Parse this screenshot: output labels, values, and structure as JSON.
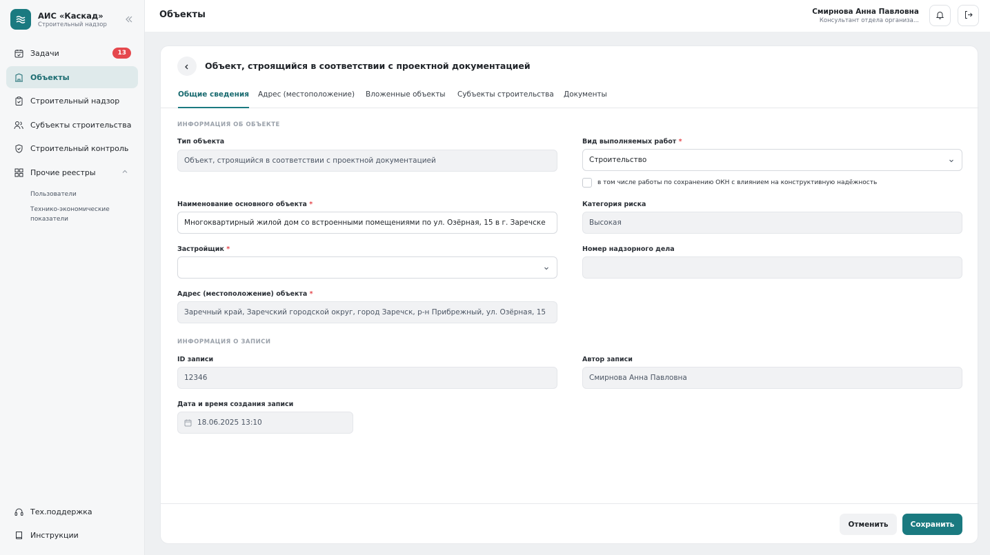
{
  "app": {
    "title": "АИС «Каскад»",
    "subtitle": "Строительный надзор"
  },
  "sidebar": {
    "items": [
      {
        "label": "Задачи",
        "badge": "13"
      },
      {
        "label": "Объекты"
      },
      {
        "label": "Строительный надзор"
      },
      {
        "label": "Субъекты строительства"
      },
      {
        "label": "Строительный контроль"
      },
      {
        "label": "Прочие реестры"
      }
    ],
    "sub_items": [
      "Пользователи",
      "Технико-экономические показатели"
    ],
    "bottom": [
      "Тех.поддержка",
      "Инструкции"
    ]
  },
  "header": {
    "page_title": "Объекты",
    "user_name": "Смирнова Анна Павловна",
    "user_role": "Консультант отдела организа..."
  },
  "card": {
    "title": "Объект, строящийся в соответствии с проектной документацией",
    "tabs": [
      "Общие сведения",
      "Адрес (местоположение)",
      "Вложенные объекты",
      "Субъекты строительства",
      "Документы"
    ],
    "section_object": "ИНФОРМАЦИЯ ОБ ОБЪЕКТЕ",
    "section_record": "ИНФОРМАЦИЯ О ЗАПИСИ",
    "fields": {
      "object_type": {
        "label": "Тип объекта",
        "value": "Объект, строящийся в соответствии с проектной документацией"
      },
      "work_type": {
        "label": "Вид выполняемых работ",
        "value": "Строительство"
      },
      "okn_checkbox": {
        "label": "в том числе работы по сохранению ОКН с влиянием на конструктивную надёжность"
      },
      "main_name": {
        "label": "Наименование основного объекта",
        "value": "Многоквартирный жилой дом со встроенными помещениями по ул. Озёрная, 15 в г. Заречске"
      },
      "risk": {
        "label": "Категория риска",
        "value": "Высокая"
      },
      "developer": {
        "label": "Застройщик",
        "value": ""
      },
      "case_number": {
        "label": "Номер надзорного дела",
        "value": ""
      },
      "address": {
        "label": "Адрес (местоположение) объекта",
        "value": "Заречный край, Заречский городской округ, город Заречск, р-н Прибрежный, ул. Озёрная, 15"
      },
      "record_id": {
        "label": "ID записи",
        "value": "12346"
      },
      "author": {
        "label": "Автор записи",
        "value": "Смирнова Анна Павловна"
      },
      "created": {
        "label": "Дата и время создания записи",
        "value": "18.06.2025 13:10"
      }
    },
    "required_mark": "*",
    "buttons": {
      "cancel": "Отменить",
      "save": "Сохранить"
    }
  }
}
